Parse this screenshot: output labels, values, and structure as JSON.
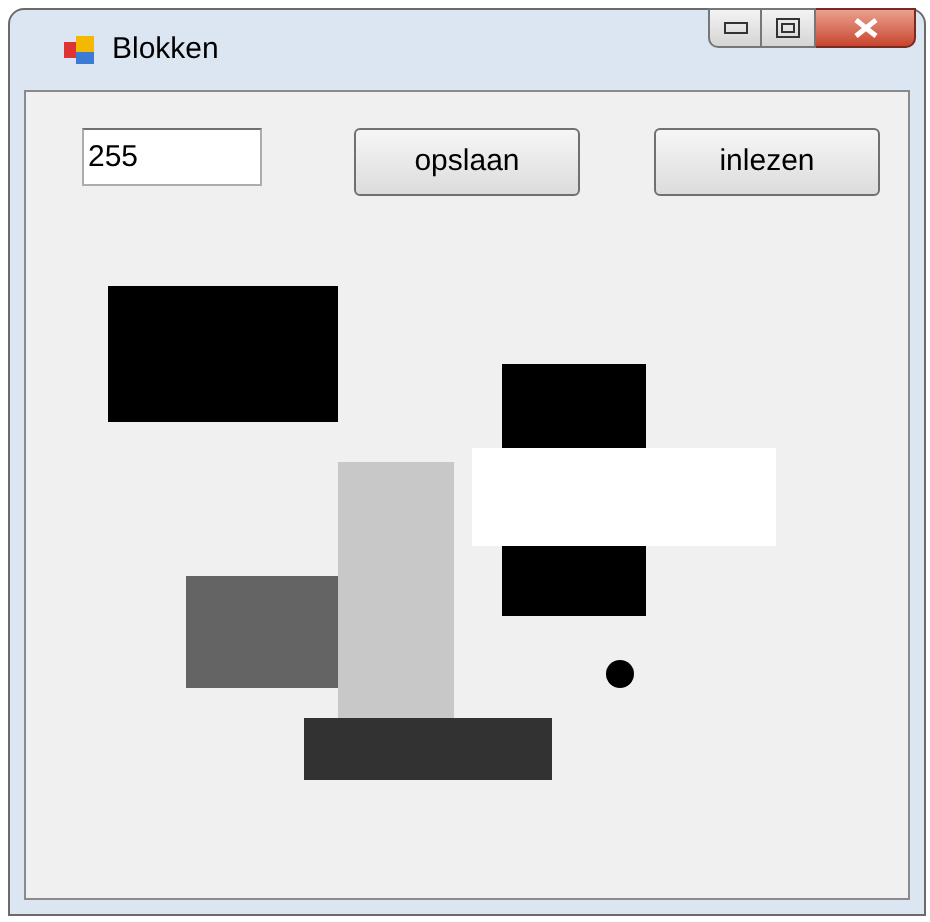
{
  "window": {
    "title": "Blokken"
  },
  "field": {
    "value": "255"
  },
  "buttons": [
    "opslaan",
    "inlezen"
  ],
  "blocks": [
    {
      "kind": "rect",
      "color": "#000000"
    },
    {
      "kind": "rect",
      "color": "#000000"
    },
    {
      "kind": "rect",
      "color": "#ffffff"
    },
    {
      "kind": "rect",
      "color": "#646464"
    },
    {
      "kind": "rect",
      "color": "#c8c8c8"
    },
    {
      "kind": "rect",
      "color": "#323232"
    },
    {
      "kind": "dot",
      "color": "#000000"
    }
  ]
}
